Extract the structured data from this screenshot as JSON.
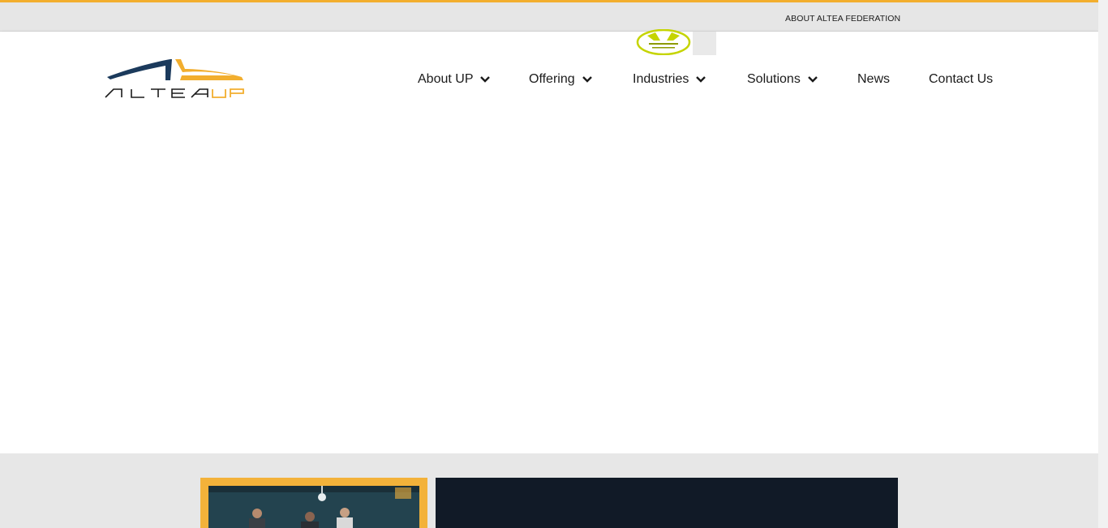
{
  "topbar": {
    "link_label": "ABOUT ALTEA FEDERATION",
    "accent_color": "#f2ae2e"
  },
  "header": {
    "logo": {
      "alt": "Altea UP logo",
      "icon": "altea-up-logo"
    },
    "federation_badge": {
      "icon": "altea-federation-badge"
    }
  },
  "nav": {
    "items": [
      {
        "label": "About UP",
        "has_dropdown": true
      },
      {
        "label": "Offering",
        "has_dropdown": true
      },
      {
        "label": "Industries",
        "has_dropdown": true
      },
      {
        "label": "Solutions",
        "has_dropdown": true
      },
      {
        "label": "News",
        "has_dropdown": false
      },
      {
        "label": "Contact Us",
        "has_dropdown": false
      }
    ]
  },
  "colors": {
    "brand_navy": "#1b3a5c",
    "brand_yellow": "#f2ae2e",
    "badge_lime": "#c5d400",
    "dark_panel": "#111a27"
  }
}
